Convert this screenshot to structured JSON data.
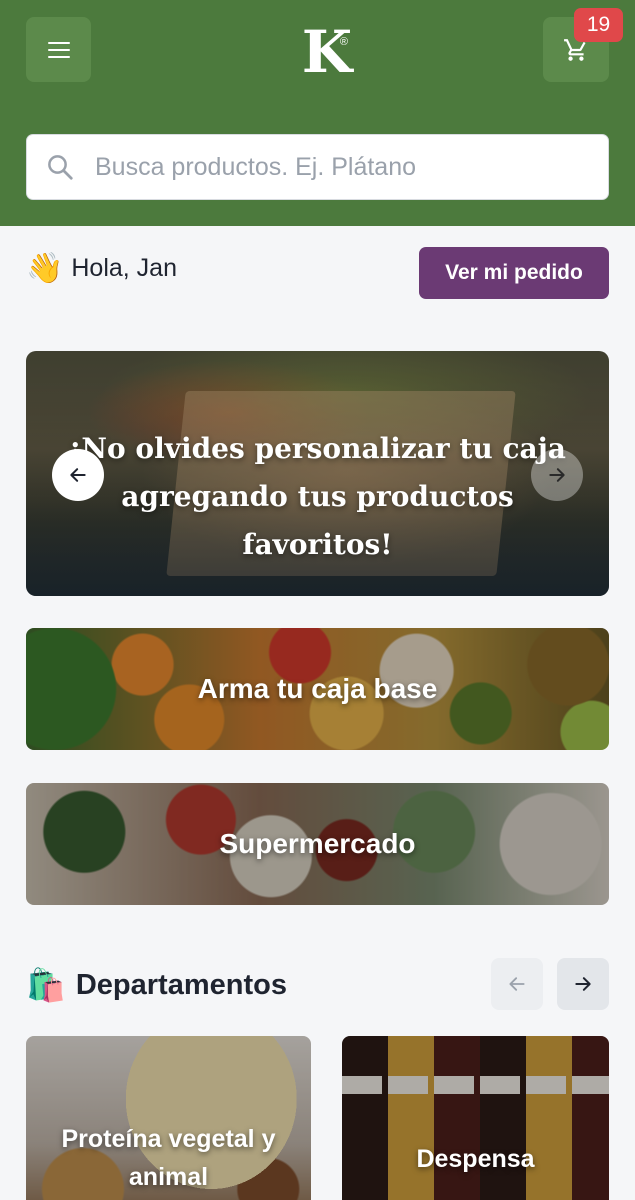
{
  "header": {
    "logo_text": "K",
    "logo_mark": "®",
    "cart_count": "19",
    "menu_icon": "hamburger-menu-icon",
    "cart_icon": "shopping-cart-icon"
  },
  "search": {
    "placeholder": "Busca productos. Ej. Plátano",
    "value": "",
    "icon": "search-icon"
  },
  "greeting": {
    "emoji": "👋",
    "text": "Hola, Jan"
  },
  "order_button_label": "Ver mi pedido",
  "banner": {
    "text": "¡No olvides personalizar tu caja agregando tus productos favoritos!"
  },
  "cards": [
    {
      "label": "Arma tu caja base"
    },
    {
      "label": "Supermercado"
    }
  ],
  "departments": {
    "emoji": "🛍️",
    "title": "Departamentos",
    "items": [
      {
        "label": "Proteína vegetal y animal"
      },
      {
        "label": "Despensa"
      }
    ]
  },
  "colors": {
    "header_green": "#4c7a3d",
    "accent_purple": "#6b3a74",
    "badge_red": "#e0484a"
  }
}
